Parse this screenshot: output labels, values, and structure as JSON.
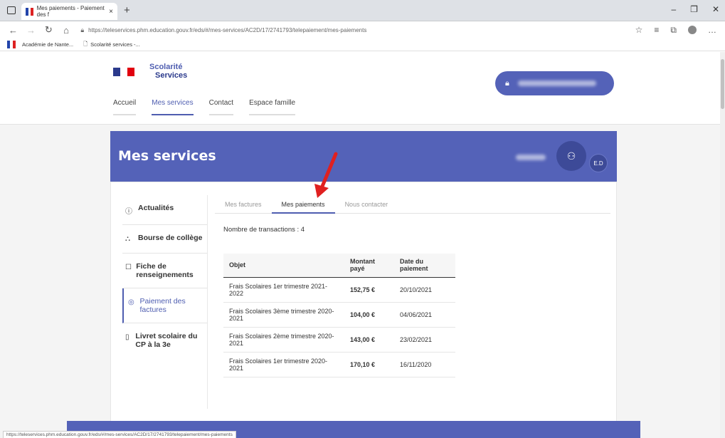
{
  "browser": {
    "tab_title": "Mes paiements - Paiement des f",
    "tab_close": "×",
    "new_tab": "+",
    "url": "https://teleservices.phm.education.gouv.fr/eds/#/mes-services/AC2D/17/2741793/telepaiement/mes-paiements",
    "bookmarks": [
      "Académie de Nante...",
      "Scolarité services -..."
    ],
    "status_url": "https://teleservices.phm.education.gouv.fr/eds/#/mes-services/AC2D/17/2741793/telepaiement/mes-paiements"
  },
  "header": {
    "brand_line1": "Scolarité",
    "brand_line2": "Services",
    "nav": [
      "Accueil",
      "Mes services",
      "Contact",
      "Espace famille"
    ]
  },
  "banner": {
    "title": "Mes services",
    "initials": "E.D"
  },
  "sidebar": {
    "items": [
      {
        "icon": "ⓘ",
        "label": "Actualités"
      },
      {
        "icon": "⛬",
        "label": "Bourse de collège"
      },
      {
        "icon": "☐",
        "label": "Fiche de renseignements"
      },
      {
        "icon": "◎",
        "label": "Paiement des factures"
      },
      {
        "icon": "▯",
        "label": "Livret scolaire du CP à la 3e"
      }
    ]
  },
  "tabs": [
    "Mes factures",
    "Mes paiements",
    "Nous contacter"
  ],
  "transactions": {
    "count_text": "Nombre de transactions : 4",
    "headers": [
      "Objet",
      "Montant payé",
      "Date du paiement"
    ],
    "rows": [
      [
        "Frais Scolaires 1er trimestre 2021-2022",
        "152,75 €",
        "20/10/2021"
      ],
      [
        "Frais Scolaires 3ème trimestre 2020-2021",
        "104,00 €",
        "04/06/2021"
      ],
      [
        "Frais Scolaires 2ème trimestre 2020-2021",
        "143,00 €",
        "23/02/2021"
      ],
      [
        "Frais Scolaires 1er trimestre 2020-2021",
        "170,10 €",
        "16/11/2020"
      ]
    ]
  },
  "colors": {
    "accent": "#5462b8",
    "accent_dark": "#3d4a98",
    "arrow": "#e02020"
  }
}
